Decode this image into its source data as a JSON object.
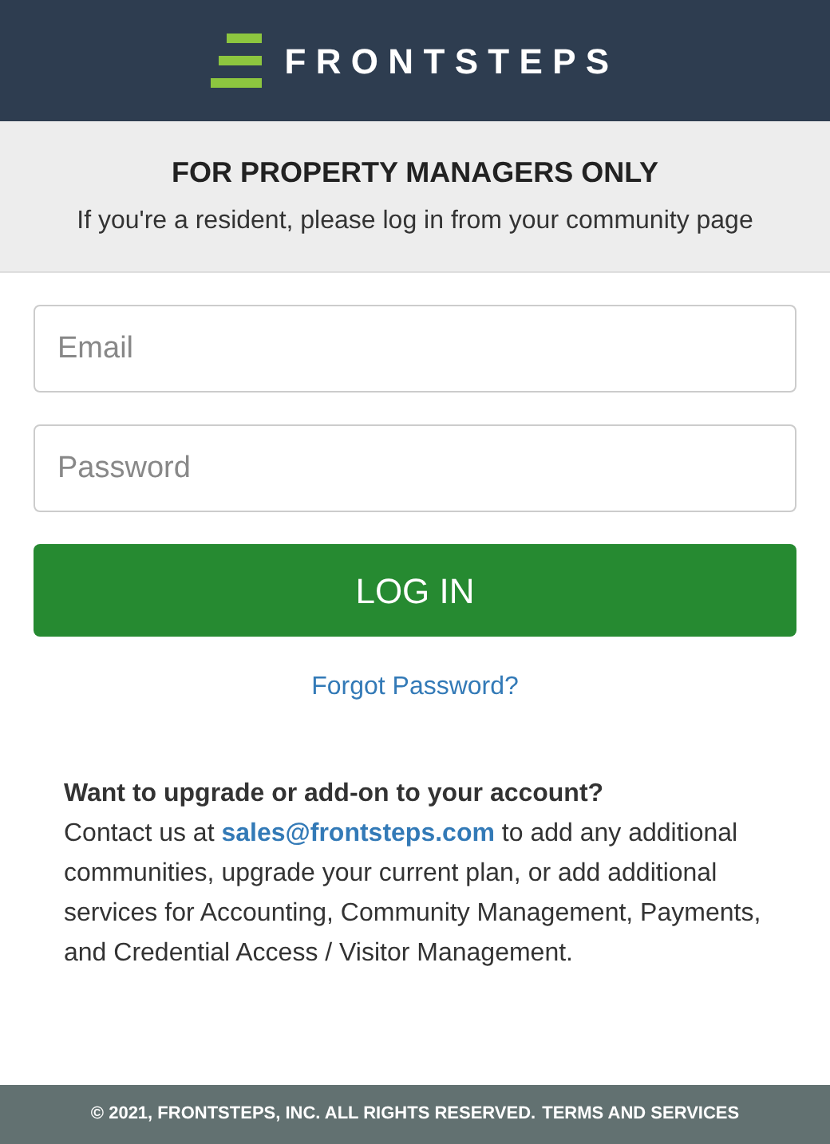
{
  "header": {
    "logo_text": "FRONTSTEPS"
  },
  "notice": {
    "title": "FOR PROPERTY MANAGERS ONLY",
    "subtitle": "If you're a resident, please log in from your community page"
  },
  "form": {
    "email": {
      "placeholder": "Email"
    },
    "password": {
      "placeholder": "Password"
    },
    "submit": "LOG IN",
    "forgot_link": "Forgot Password?"
  },
  "upsell": {
    "title": "Want to upgrade or add-on to your account?",
    "text_before": "Contact us at",
    "email_link": "sales@frontsteps.com",
    "text_after": "to add any additional communities, upgrade your current plan, or add additional services for Accounting, Community Management, Payments, and Credential Access / Visitor Management."
  },
  "footer": {
    "copyright": "© 2021, FRONTSTEPS, INC. ALL RIGHTS RESERVED.",
    "terms_link": "TERMS AND SERVICES"
  }
}
